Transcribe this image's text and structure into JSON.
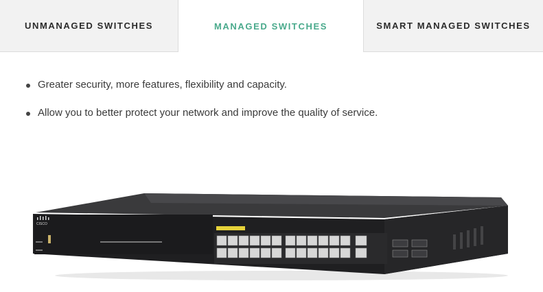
{
  "tabs": [
    {
      "label": "UNMANAGED SWITCHES",
      "active": false
    },
    {
      "label": "MANAGED SWITCHES",
      "active": true
    },
    {
      "label": "SMART MANAGED SWITCHES",
      "active": false
    }
  ],
  "colors": {
    "active_tab": "#4aaa8c",
    "tab_text": "#2b2b2b",
    "tab_bg": "#f2f2f2"
  },
  "bullets": [
    "Greater security, more features, flexibility and capacity.",
    "Allow you to better protect your network and improve the quality of service."
  ],
  "product_image": {
    "icon": "network-switch-image",
    "brand": "cisco"
  }
}
